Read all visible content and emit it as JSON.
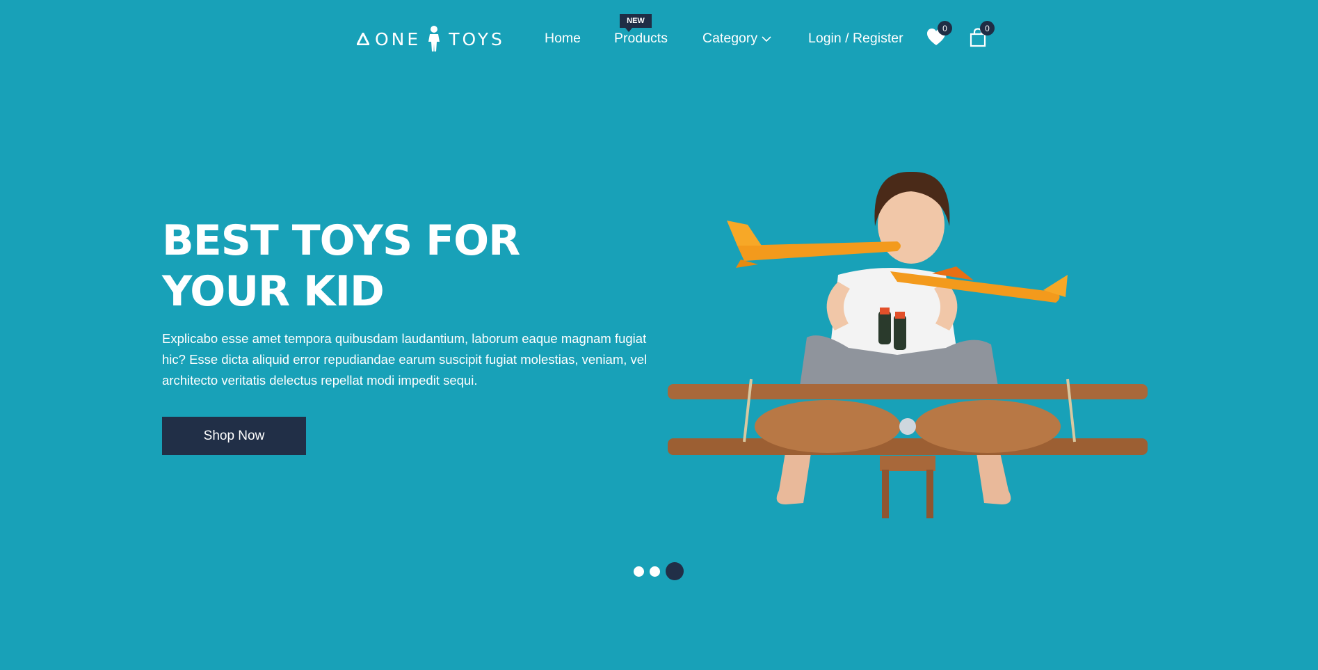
{
  "brand": {
    "left": "ONE",
    "right": "TOYS"
  },
  "nav": {
    "home": "Home",
    "products": "Products",
    "products_badge": "NEW",
    "category": "Category",
    "login": "Login / Register"
  },
  "header_icons": {
    "wishlist": {
      "icon": "heart-icon",
      "count": "0"
    },
    "cart": {
      "icon": "shopping-bag-icon",
      "count": "0"
    }
  },
  "hero": {
    "title": "BEST TOYS FOR YOUR KID",
    "description": "Explicabo esse amet tempora quibusdam laudantium, laborum eaque magnam fugiat hic? Esse dicta aliquid error repudiandae earum suscipit fugiat molestias, veniam, vel architecto veritatis delectus repellat modi impedit sequi.",
    "cta": "Shop Now",
    "image": "child-with-toy-airplanes"
  },
  "slider": {
    "slide_count": 3,
    "active_index": 2
  },
  "colors": {
    "background": "#18a1b8",
    "dark": "#212f47",
    "text": "#ffffff",
    "wood": "#a8683a",
    "toy_orange": "#f39a1c"
  }
}
